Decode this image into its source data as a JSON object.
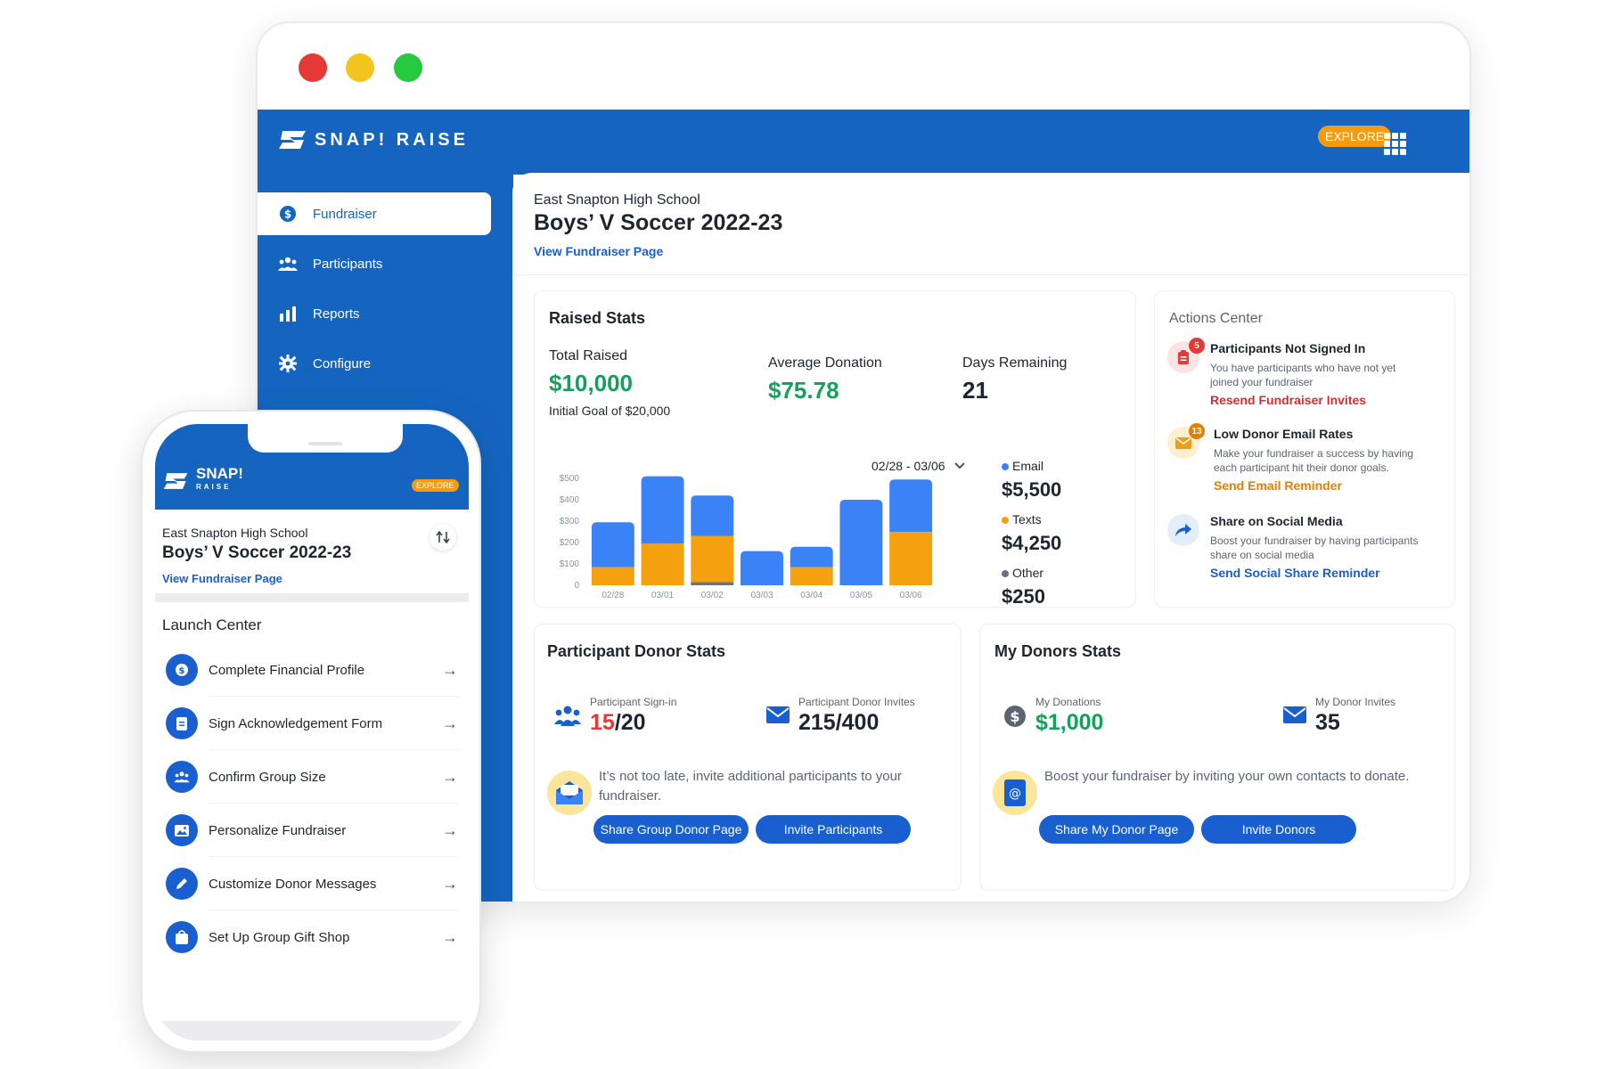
{
  "brand": {
    "logo_text": "SNAP! RAISE",
    "phone_logo_main": "SNAP!",
    "phone_logo_sub": "RAISE",
    "explore_label": "EXPLORE",
    "primary_color": "#1565c0",
    "accent_orange": "#f39c12"
  },
  "sidebar": {
    "items": [
      {
        "label": "Fundraiser",
        "icon": "dollar-circle-icon",
        "active": true
      },
      {
        "label": "Participants",
        "icon": "people-group-icon",
        "active": false
      },
      {
        "label": "Reports",
        "icon": "bar-chart-icon",
        "active": false
      },
      {
        "label": "Configure",
        "icon": "gear-icon",
        "active": false
      }
    ]
  },
  "header": {
    "school": "East Snapton High School",
    "title": "Boys’ V Soccer 2022-23",
    "link": "View Fundraiser Page"
  },
  "raised_stats": {
    "title": "Raised Stats",
    "total_label": "Total Raised",
    "total_value": "$10,000",
    "goal_text": "Initial Goal of $20,000",
    "avg_label": "Average Donation",
    "avg_value": "$75.78",
    "days_label": "Days Remaining",
    "days_value": "21",
    "date_range": "02/28 - 03/06",
    "legend": [
      {
        "name": "Email",
        "value": "$5,500",
        "color": "#3b82f6"
      },
      {
        "name": "Texts",
        "value": "$4,250",
        "color": "#f5a00f"
      },
      {
        "name": "Other",
        "value": "$250",
        "color": "#6b7280"
      }
    ]
  },
  "chart_data": {
    "type": "bar",
    "stacked": true,
    "categories": [
      "02/28",
      "03/01",
      "03/02",
      "03/03",
      "03/04",
      "03/05",
      "03/06"
    ],
    "series": [
      {
        "name": "Other",
        "values": [
          0,
          0,
          15,
          0,
          0,
          0,
          0
        ],
        "color": "#6b7280"
      },
      {
        "name": "Texts",
        "values": [
          85,
          195,
          215,
          0,
          85,
          0,
          250
        ],
        "color": "#f5a00f"
      },
      {
        "name": "Email",
        "values": [
          210,
          315,
          190,
          160,
          95,
          400,
          245
        ],
        "color": "#3b82f6"
      }
    ],
    "yticks": [
      "0",
      "$100",
      "$200",
      "$300",
      "$400",
      "$500"
    ],
    "ylim": [
      0,
      500
    ]
  },
  "actions_center": {
    "title": "Actions Center",
    "items": [
      {
        "title": "Participants Not Signed In",
        "desc": "You have participants who have not yet joined your fundraiser",
        "action": "Resend Fundraiser Invites",
        "badge": "5",
        "action_color": "#d32f2f",
        "icon": "clipboard-icon"
      },
      {
        "title": "Low Donor Email Rates",
        "desc": "Make your fundraiser a success by having each participant hit their donor goals.",
        "action": "Send Email Reminder",
        "badge": "13",
        "action_color": "#e67e00",
        "icon": "envelope-icon"
      },
      {
        "title": "Share on Social Media",
        "desc": "Boost your fundraiser by having participants share on social media",
        "action": "Send Social Share Reminder",
        "badge": "",
        "action_color": "#1a5fd0",
        "icon": "share-arrow-icon"
      }
    ]
  },
  "participant_donor_stats": {
    "title": "Participant Donor Stats",
    "signin_label": "Participant Sign-in",
    "signin_num": "15",
    "signin_total": "/20",
    "invites_label": "Participant Donor Invites",
    "invites_value": "215/400",
    "message": "It’s not too late, invite additional participants to your fundraiser.",
    "btn1": "Share Group Donor Page",
    "btn2": "Invite Participants"
  },
  "my_donors_stats": {
    "title": "My Donors Stats",
    "donations_label": "My Donations",
    "donations_value": "$1,000",
    "invites_label": "My Donor Invites",
    "invites_value": "35",
    "message": "Boost your fundraiser by inviting your own contacts to donate.",
    "btn1": "Share My Donor Page",
    "btn2": "Invite Donors"
  },
  "phone": {
    "school": "East Snapton High School",
    "title": "Boys’ V Soccer 2022-23",
    "link": "View Fundraiser Page",
    "launch_title": "Launch Center",
    "launch_items": [
      {
        "label": "Complete Financial Profile",
        "icon": "dollar-icon"
      },
      {
        "label": "Sign Acknowledgement Form",
        "icon": "document-icon"
      },
      {
        "label": "Confirm Group Size",
        "icon": "group-icon"
      },
      {
        "label": "Personalize Fundraiser",
        "icon": "image-icon"
      },
      {
        "label": "Customize Donor Messages",
        "icon": "pencil-icon"
      },
      {
        "label": "Set Up Group Gift Shop",
        "icon": "shopping-bag-icon"
      }
    ]
  }
}
